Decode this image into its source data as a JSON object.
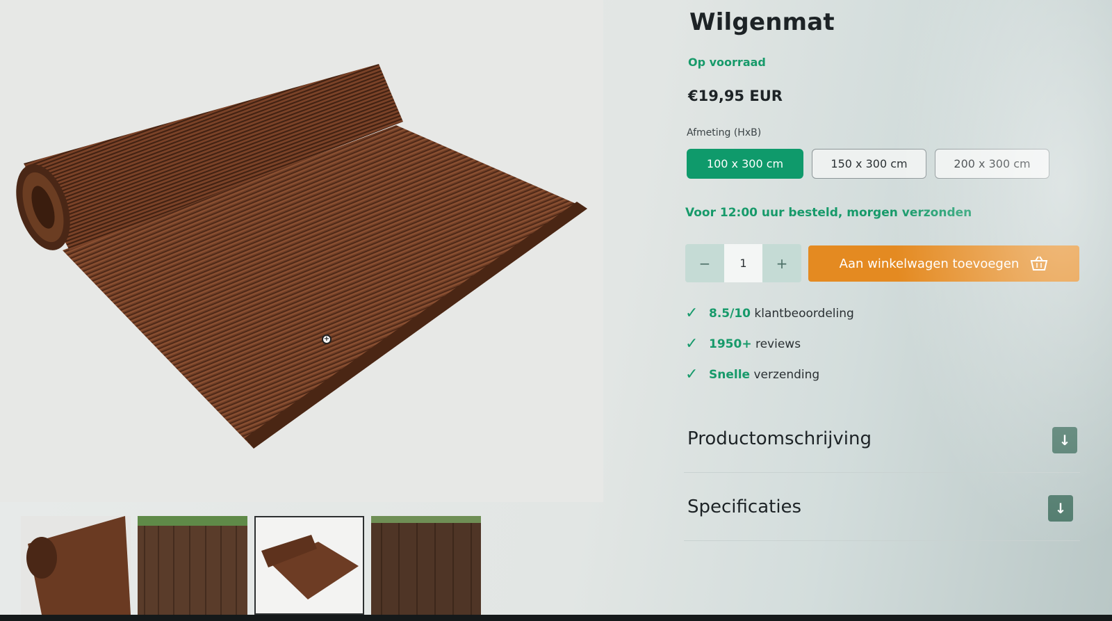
{
  "product": {
    "title": "Wilgenmat",
    "stock_status": "Op voorraad",
    "price": "€19,95 EUR",
    "size_label": "Afmeting (HxB)",
    "sizes": [
      {
        "label": "100 x 300 cm",
        "selected": true
      },
      {
        "label": "150 x 300 cm",
        "selected": false
      },
      {
        "label": "200 x 300 cm",
        "selected": false
      }
    ],
    "shipping_note": "Voor 12:00 uur besteld, morgen verzonden"
  },
  "cart": {
    "minus": "−",
    "quantity": "1",
    "plus": "+",
    "add_label": "Aan winkelwagen toevoegen",
    "icon": "basket-icon"
  },
  "usps": [
    {
      "highlight": "8.5/10",
      "text": "klantbeoordeling"
    },
    {
      "highlight": "1950+",
      "text": "reviews"
    },
    {
      "highlight": "Snelle",
      "text": "verzending"
    }
  ],
  "accordions": [
    {
      "title": "Productomschrijving",
      "toggle": "↓"
    },
    {
      "title": "Specificaties",
      "toggle": "↓"
    }
  ],
  "gallery": {
    "thumbnail_count": 4,
    "active_thumbnail": 3,
    "zoom_icon": "zoom-in-icon"
  },
  "colors": {
    "accent_green": "#0f9a6b",
    "cart_orange": "#e48a21",
    "willow_brown": "#6b3f26"
  }
}
